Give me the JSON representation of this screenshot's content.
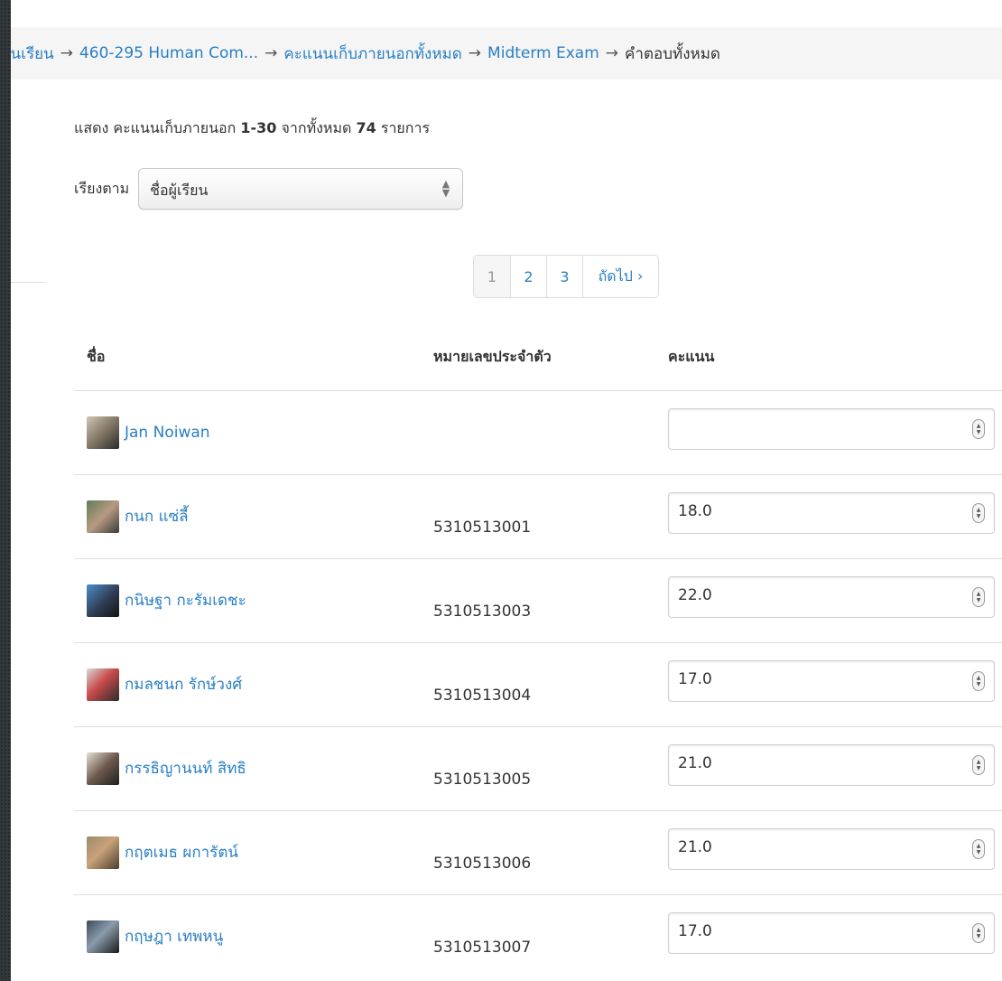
{
  "breadcrumb": {
    "items": [
      {
        "label": "ชั้นเรียน",
        "link": true
      },
      {
        "label": "460-295 Human Com...",
        "link": true
      },
      {
        "label": "คะแนนเก็บภายนอกทั้งหมด",
        "link": true
      },
      {
        "label": "Midterm Exam",
        "link": true
      },
      {
        "label": "คำตอบทั้งหมด",
        "link": false
      }
    ],
    "separator": "→"
  },
  "summary": {
    "prefix": "แสดง คะแนนเก็บภายนอก ",
    "range": "1-30",
    "middle": " จากทั้งหมด ",
    "total": "74",
    "suffix": " รายการ"
  },
  "sort": {
    "label": "เรียงตาม",
    "selected": "ชื่อผู้เรียน"
  },
  "pagination": {
    "pages": [
      "1",
      "2",
      "3"
    ],
    "current": "1",
    "next_label": "ถัดไป ›"
  },
  "table": {
    "headers": {
      "name": "ชื่อ",
      "student_id": "หมายเลขประจำตัว",
      "score": "คะแนน"
    },
    "rows": [
      {
        "name": "Jan Noiwan",
        "student_id": "",
        "score": ""
      },
      {
        "name": "กนก แซ่ลี้",
        "student_id": "5310513001",
        "score": "18.0"
      },
      {
        "name": "กนิษฐา กะรัมเดชะ",
        "student_id": "5310513003",
        "score": "22.0"
      },
      {
        "name": "กมลชนก รักษ์วงศ์",
        "student_id": "5310513004",
        "score": "17.0"
      },
      {
        "name": "กรรธิญานนท์ สิทธิ",
        "student_id": "5310513005",
        "score": "21.0"
      },
      {
        "name": "กฤตเมธ ผการัตน์",
        "student_id": "5310513006",
        "score": "21.0"
      },
      {
        "name": "กฤษฎา เทพหนู",
        "student_id": "5310513007",
        "score": "17.0"
      }
    ]
  },
  "colors": {
    "link": "#2a7fc4",
    "text": "#333333",
    "background": "#34383a",
    "panel": "#ffffff"
  }
}
